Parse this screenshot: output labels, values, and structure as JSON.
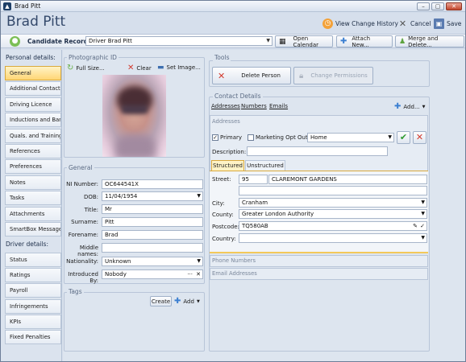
{
  "window": {
    "title": "Brad Pitt",
    "min": "–",
    "max": "▢",
    "close": "✕"
  },
  "header": {
    "name": "Brad Pitt",
    "view_history": "View Change History",
    "cancel": "Cancel",
    "save": "Save"
  },
  "recordbar": {
    "label": "Candidate Records:",
    "value": "Driver Brad Pitt",
    "open_calendar": "Open Calendar",
    "attach_new": "Attach New...",
    "merge_delete": "Merge and Delete..."
  },
  "sidebar": {
    "personal_header": "Personal details:",
    "personal_items": [
      "General",
      "Additional Contacts",
      "Driving Licence",
      "Inductions and Bans",
      "Quals. and Training",
      "References",
      "Preferences",
      "Notes",
      "Tasks",
      "Attachments",
      "SmartBox Messages"
    ],
    "driver_header": "Driver details:",
    "driver_items": [
      "Status",
      "Ratings",
      "Payroll",
      "Infringements",
      "KPIs",
      "Fixed Penalties"
    ]
  },
  "photo": {
    "title": "Photographic ID",
    "full_size": "Full Size...",
    "clear": "Clear",
    "set_image": "Set Image..."
  },
  "general": {
    "title": "General",
    "ni_label": "NI Number:",
    "ni": "OC644541X",
    "dob_label": "DOB:",
    "dob": "11/04/1954",
    "title_label": "Title:",
    "title_val": "Mr",
    "surname_label": "Surname:",
    "surname": "Pitt",
    "forename_label": "Forename:",
    "forename": "Brad",
    "middle_label": "Middle names:",
    "middle": "",
    "nationality_label": "Nationality:",
    "nationality": "Unknown",
    "introduced_label": "Introduced By:",
    "introduced": "Nobody"
  },
  "tags": {
    "title": "Tags",
    "create": "Create",
    "add": "Add"
  },
  "tools": {
    "title": "Tools",
    "delete_person": "Delete Person",
    "change_permissions": "Change Permissions"
  },
  "contact": {
    "title": "Contact Details",
    "tabs": [
      "Addresses",
      "Numbers",
      "Emails"
    ],
    "add": "Add...",
    "addresses_label": "Addresses",
    "primary": "Primary",
    "marketing": "Marketing Opt Out",
    "addr_type": "Home",
    "description_label": "Description:",
    "subtabs": [
      "Structured",
      "Unstructured"
    ],
    "street_label": "Street:",
    "street_no": "95",
    "street_name": "CLAREMONT GARDENS",
    "city_label": "City:",
    "city": "Cranham",
    "county_label": "County:",
    "county": "Greater London Authority",
    "postcode_label": "Postcode:",
    "postcode": "TQ580AB",
    "country_label": "Country:",
    "country": "",
    "phone_label": "Phone Numbers",
    "email_label": "Email Addresses"
  },
  "colors": {
    "accent": "#ffd675",
    "frame": "#d6dfec"
  }
}
